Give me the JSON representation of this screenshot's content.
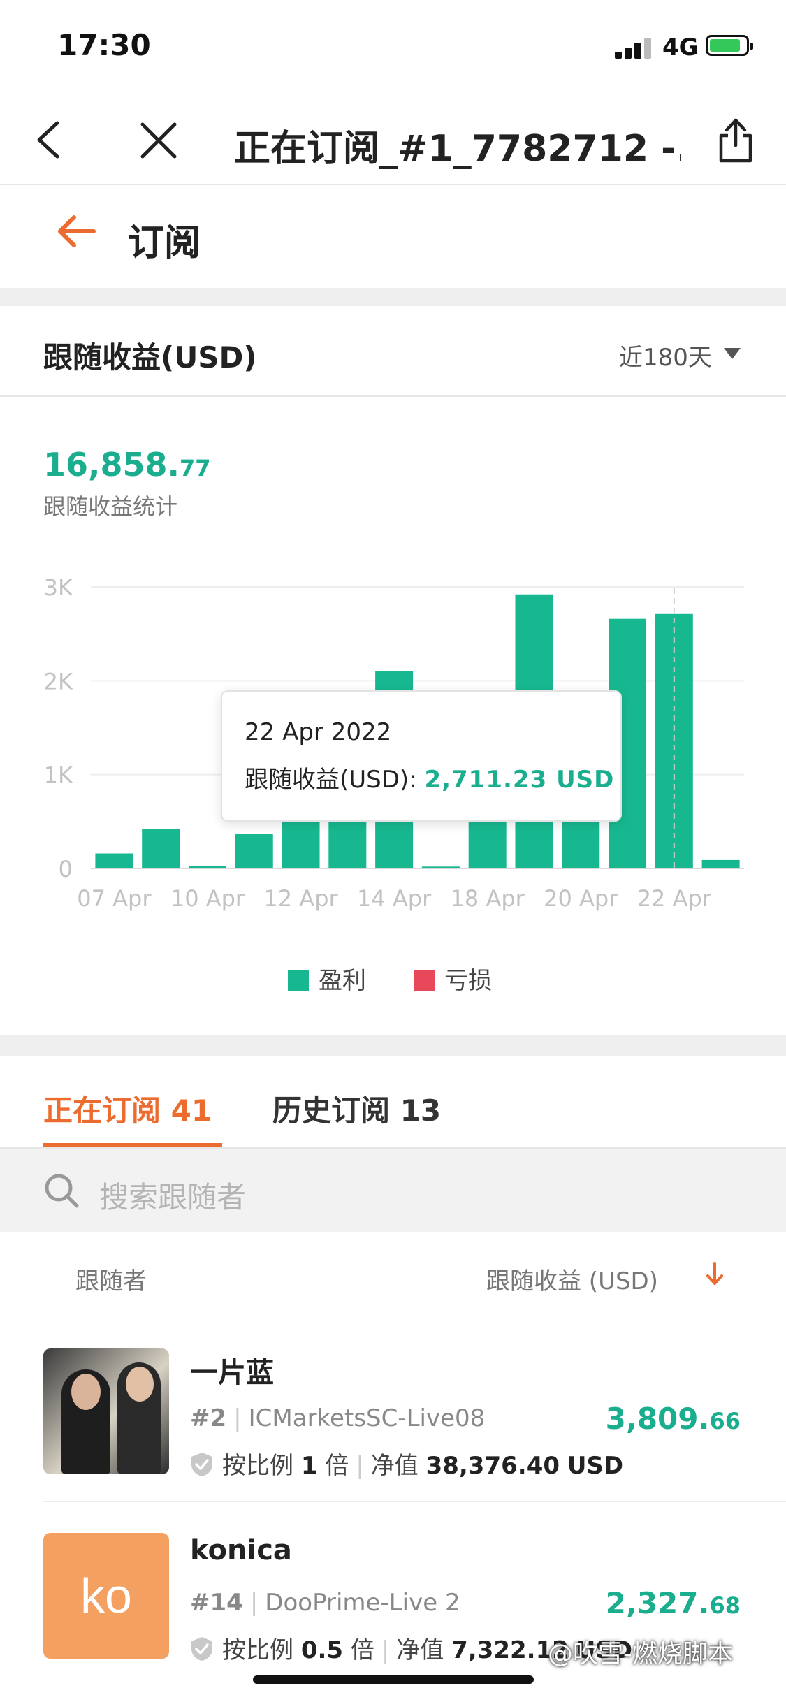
{
  "status_bar": {
    "time": "17:30",
    "network": "4G"
  },
  "nav": {
    "title": "正在订阅_#1_7782712 -..."
  },
  "header": {
    "title": "订阅"
  },
  "earnings": {
    "title": "跟随收益(USD)",
    "period": "近180天",
    "total_int": "16,858.",
    "total_dec": "77",
    "total_label": "跟随收益统计"
  },
  "chart_data": {
    "type": "bar",
    "ylim": [
      0,
      3000
    ],
    "yticks": [
      "0",
      "1K",
      "2K",
      "3K"
    ],
    "x_tick_labels": [
      "07 Apr",
      "10 Apr",
      "12 Apr",
      "14 Apr",
      "18 Apr",
      "20 Apr",
      "22 Apr"
    ],
    "series": [
      {
        "name": "盈利",
        "color": "#17b890",
        "values": [
          160,
          420,
          30,
          370,
          900,
          900,
          2100,
          20,
          900,
          2920,
          900,
          2660,
          2711.23,
          90
        ]
      }
    ],
    "highlight_index": 12,
    "grid": true,
    "legend": [
      {
        "label": "盈利",
        "color": "#17b890"
      },
      {
        "label": "亏损",
        "color": "#e8485a"
      }
    ],
    "tooltip": {
      "date": "22 Apr 2022",
      "label": "跟随收益(USD):",
      "value": "2,711.23 USD"
    }
  },
  "tabs": [
    {
      "label": "正在订阅",
      "count": "41"
    },
    {
      "label": "历史订阅",
      "count": "13"
    }
  ],
  "search": {
    "placeholder": "搜索跟随者"
  },
  "list_header": {
    "left": "跟随者",
    "right": "跟随收益 (USD)"
  },
  "followers": [
    {
      "name": "一片蓝",
      "rank": "#2",
      "server": "ICMarketsSC-Live08",
      "amount_int": "3,809.",
      "amount_dec": "66",
      "ratio_label": "按比例",
      "ratio": "1",
      "ratio_unit": "倍",
      "equity_label": "净值",
      "equity": "38,376.40",
      "equity_unit": "USD"
    },
    {
      "name": "konica",
      "initials": "ko",
      "rank": "#14",
      "server": "DooPrime-Live 2",
      "amount_int": "2,327.",
      "amount_dec": "68",
      "ratio_label": "按比例",
      "ratio": "0.5",
      "ratio_unit": "倍",
      "equity_label": "净值",
      "equity": "7,322.12",
      "equity_unit": "USD"
    }
  ],
  "watermark": "@吹雪-燃烧脚本"
}
